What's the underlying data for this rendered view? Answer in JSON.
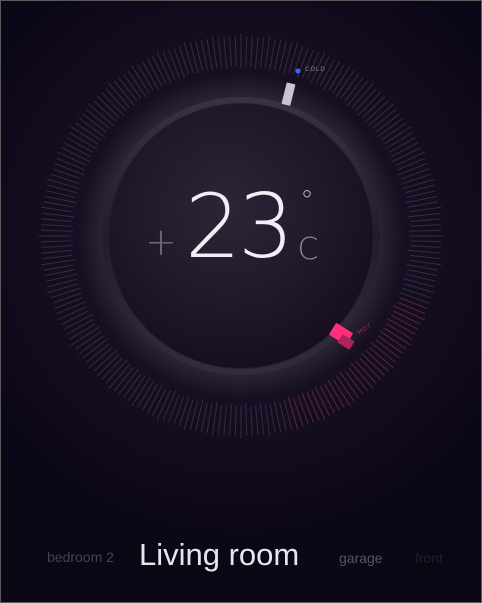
{
  "thermostat": {
    "sign": "+",
    "value": "23",
    "degree_symbol": "°",
    "unit": "C",
    "cold_label": "COLD",
    "hot_label": "HOT"
  },
  "rooms": {
    "left": "bedroom 2",
    "current": "Living room",
    "right": "garage",
    "far_right": "front"
  },
  "colors": {
    "background": "#0c0716",
    "cold_accent": "#3f63ff",
    "hot_accent": "#ff2f7a",
    "text_primary": "#f1eef6",
    "text_dim": "#47414f"
  }
}
